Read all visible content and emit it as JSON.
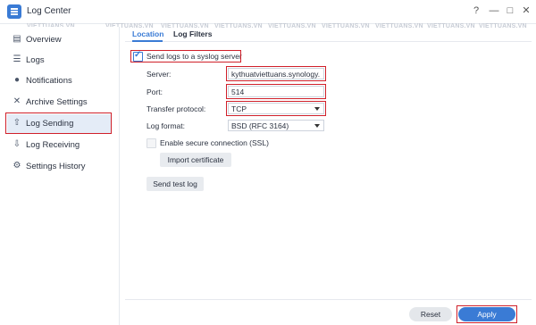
{
  "window": {
    "title": "Log Center",
    "controls": {
      "help": "?",
      "minimize": "—",
      "maximize": "□",
      "close": "✕"
    }
  },
  "watermark": "VIETTUANS.VN",
  "sidebar": {
    "items": [
      {
        "label": "Overview",
        "icon": "overview-icon"
      },
      {
        "label": "Logs",
        "icon": "list-icon"
      },
      {
        "label": "Notifications",
        "icon": "speech-bubble-icon"
      },
      {
        "label": "Archive Settings",
        "icon": "wrench-icon"
      },
      {
        "label": "Log Sending",
        "icon": "export-icon",
        "active": true
      },
      {
        "label": "Log Receiving",
        "icon": "import-icon"
      },
      {
        "label": "Settings History",
        "icon": "gear-icon"
      }
    ]
  },
  "tabs": [
    {
      "label": "Location",
      "active": true
    },
    {
      "label": "Log Filters"
    }
  ],
  "form": {
    "send_checkbox_label": "Send logs to a syslog server",
    "send_checked": true,
    "server_label": "Server:",
    "server_value": "kythuatviettuans.synology.",
    "port_label": "Port:",
    "port_value": "514",
    "protocol_label": "Transfer protocol:",
    "protocol_value": "TCP",
    "format_label": "Log format:",
    "format_value": "BSD (RFC 3164)",
    "ssl_label": "Enable secure connection (SSL)",
    "ssl_checked": false,
    "import_cert_button": "Import certificate",
    "send_test_button": "Send test log"
  },
  "footer": {
    "reset": "Reset",
    "apply": "Apply"
  },
  "colors": {
    "accent": "#3a7bd5",
    "highlight": "#d0202a"
  }
}
